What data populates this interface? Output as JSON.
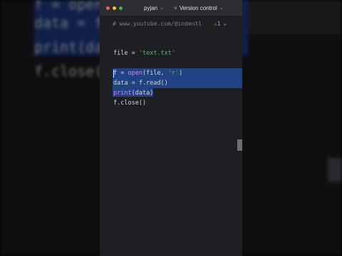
{
  "window": {
    "project_name": "pyjan",
    "vcs_label": "Version control"
  },
  "icons": {
    "close": "red-dot",
    "minimize": "yellow-dot",
    "maximize": "green-dot",
    "branch": "branch-icon",
    "warning": "warning-icon",
    "chevron": "chevron-down-icon"
  },
  "editor": {
    "comment_line": "# www.youtube.com/@indentl",
    "warning_glyph": "⚠1",
    "lines": [
      {
        "parts": [
          {
            "t": "file = ",
            "c": ""
          },
          {
            "t": "'text.txt'",
            "c": "str"
          }
        ]
      },
      {
        "parts": [
          {
            "t": "f = ",
            "c": ""
          },
          {
            "t": "open",
            "c": "kw"
          },
          {
            "t": "(file, ",
            "c": ""
          },
          {
            "t": "'r'",
            "c": "str"
          },
          {
            "t": ")",
            "c": ""
          }
        ]
      },
      {
        "parts": [
          {
            "t": "data = f.read()",
            "c": ""
          }
        ]
      },
      {
        "parts": [
          {
            "t": "print",
            "c": "kw"
          },
          {
            "t": "(data)",
            "c": ""
          }
        ]
      },
      {
        "parts": [
          {
            "t": "f.close()",
            "c": ""
          }
        ]
      }
    ]
  },
  "background_echo": {
    "lines": [
      "f = open(",
      "data = f",
      "print(da",
      "f.close("
    ]
  },
  "colors": {
    "selection": "#214283",
    "string": "#6aab73",
    "keyword": "#b98cf0"
  }
}
